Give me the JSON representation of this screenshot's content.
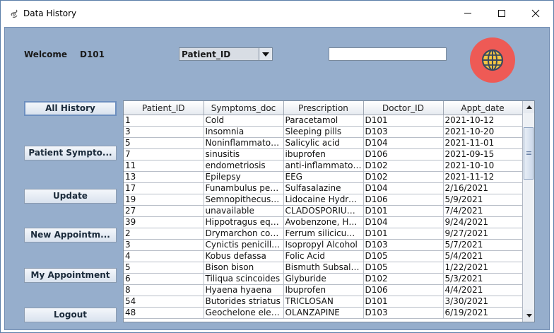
{
  "window": {
    "title": "Data History"
  },
  "header": {
    "welcome_label": "Welcome",
    "user_id": "D101",
    "filter_value": "Patient_ID",
    "search_value": ""
  },
  "sidebar": {
    "buttons": [
      "All History",
      "Patient Sympto...",
      "Update",
      "New Appointm...",
      "My Appointment",
      "Logout"
    ]
  },
  "table": {
    "columns": [
      "Patient_ID",
      "Symptoms_doc",
      "Prescription",
      "Doctor_ID",
      "Appt_date"
    ],
    "rows": [
      [
        "1",
        "Cold",
        "Paracetamol",
        "D101",
        "2021-10-12"
      ],
      [
        "3",
        "Insomnia",
        "Sleeping pills",
        "D103",
        "2021-10-20"
      ],
      [
        "5",
        "Noninflammatory ...",
        "Salicylic acid",
        "D104",
        "2021-11-01"
      ],
      [
        "7",
        "sinusitis",
        "ibuprofen",
        "D106",
        "2021-09-15"
      ],
      [
        "11",
        "endometriosis",
        "anti-inflammatory ...",
        "D102",
        "2021-10-10"
      ],
      [
        "13",
        "Epilepsy",
        "EEG",
        "D102",
        "2021-11-12"
      ],
      [
        "17",
        "Funambulus penn...",
        "Sulfasalazine",
        "D104",
        "2/16/2021"
      ],
      [
        "19",
        "Semnopithecus e...",
        "Lidocaine Hydroc...",
        "D106",
        "5/9/2021"
      ],
      [
        "27",
        "unavailable",
        "CLADOSPORIUM ...",
        "D101",
        "7/4/2021"
      ],
      [
        "39",
        "Hippotragus equi...",
        "Avobenzone, Hom...",
        "D104",
        "9/24/2021"
      ],
      [
        "2",
        "Drymarchon coria...",
        "Ferrum silicicum ...",
        "D101",
        "9/27/2021"
      ],
      [
        "3",
        "Cynictis penicillata",
        "Isopropyl Alcohol",
        "D103",
        "5/7/2021"
      ],
      [
        "4",
        "Kobus defassa",
        "Folic Acid",
        "D105",
        "5/4/2021"
      ],
      [
        "5",
        "Bison bison",
        "Bismuth Subsalic...",
        "D105",
        "1/22/2021"
      ],
      [
        "6",
        "Tiliqua scincoides",
        "Glyburide",
        "D102",
        "5/3/2021"
      ],
      [
        "8",
        "Hyaena hyaena",
        "Ibuprofen",
        "D106",
        "4/4/2021"
      ],
      [
        "54",
        "Butorides striatus",
        "TRICLOSAN",
        "D101",
        "3/30/2021"
      ],
      [
        "48",
        "Geochelone eleph...",
        "OLANZAPINE",
        "D103",
        "6/19/2021"
      ]
    ]
  },
  "icons": {
    "app": "java-app-icon",
    "globe": "globe-icon"
  },
  "colors": {
    "background": "#96aecc",
    "globe_bg": "#ee5a55"
  }
}
